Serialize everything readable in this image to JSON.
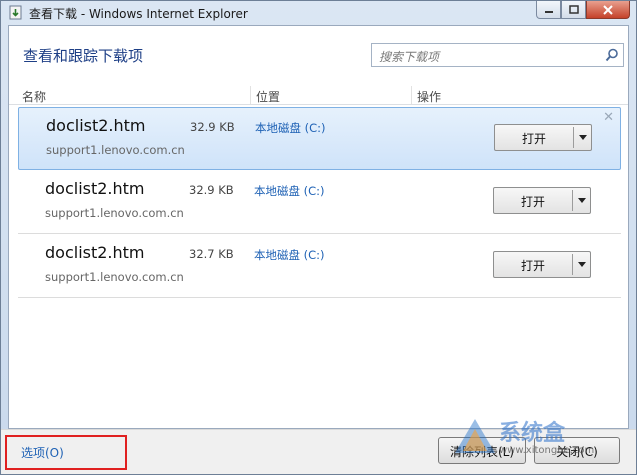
{
  "window": {
    "title": "查看下载 - Windows Internet Explorer",
    "icons": {
      "app": "download-window-icon",
      "minimize": "minimize-icon",
      "maximize": "maximize-icon",
      "close": "close-icon"
    }
  },
  "header": {
    "title": "查看和跟踪下载项",
    "search_placeholder": "搜索下载项"
  },
  "columns": {
    "name": "名称",
    "location": "位置",
    "action": "操作"
  },
  "downloads": [
    {
      "file": "doclist2.htm",
      "size": "32.9 KB",
      "location": "本地磁盘 (C:)",
      "source": "support1.lenovo.com.cn",
      "action": "打开",
      "selected": true
    },
    {
      "file": "doclist2.htm",
      "size": "32.9 KB",
      "location": "本地磁盘 (C:)",
      "source": "support1.lenovo.com.cn",
      "action": "打开",
      "selected": false
    },
    {
      "file": "doclist2.htm",
      "size": "32.7 KB",
      "location": "本地磁盘 (C:)",
      "source": "support1.lenovo.com.cn",
      "action": "打开",
      "selected": false
    }
  ],
  "footer": {
    "options": "选项(O)",
    "clear_list": "清除列表(L)",
    "close": "关闭(C)"
  },
  "watermark": {
    "brand": "系统盒",
    "url": "www.xitonghe.com"
  },
  "colors": {
    "accent_blue": "#1f62b5",
    "highlight_red": "#e02020",
    "selected_row": "#cfe3f9"
  }
}
